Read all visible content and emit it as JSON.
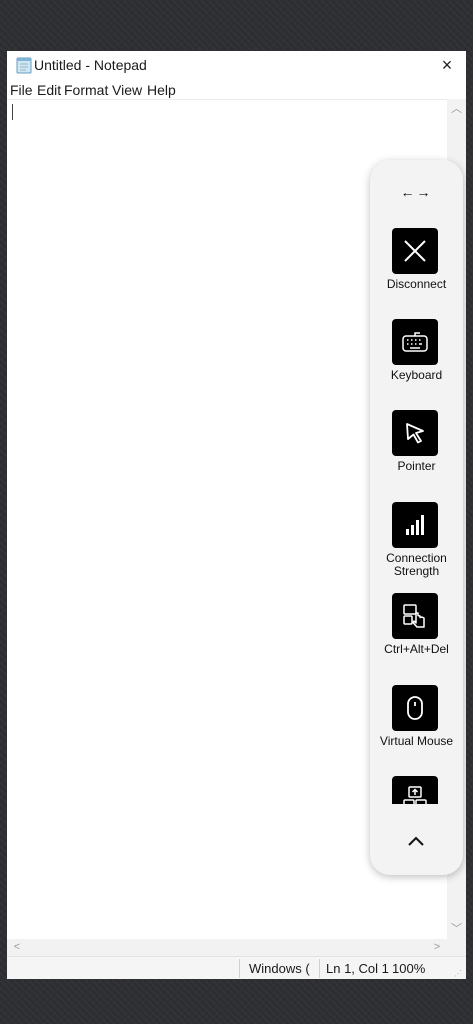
{
  "window": {
    "title": "Untitled - Notepad",
    "close_glyph": "×"
  },
  "menu": {
    "items": [
      "File",
      "Edit",
      "Format",
      "View",
      "Help"
    ]
  },
  "editor": {
    "content": ""
  },
  "statusbar": {
    "encoding": "Windows (",
    "position": "Ln 1, Col 1",
    "zoom": "100%"
  },
  "toolbar": {
    "handle": "←→",
    "items": [
      {
        "label": "Disconnect",
        "icon": "close-x-icon"
      },
      {
        "label": "Keyboard",
        "icon": "keyboard-icon"
      },
      {
        "label": "Pointer",
        "icon": "cursor-pointer-icon"
      },
      {
        "label": "Connection Strength",
        "icon": "signal-bars-icon"
      },
      {
        "label": "Ctrl+Alt+Del",
        "icon": "ctrl-alt-del-icon"
      },
      {
        "label": "Virtual Mouse",
        "icon": "mouse-icon"
      }
    ],
    "partial_item_icon": "upload-key-icon",
    "collapse_icon": "chevron-up-icon"
  },
  "colors": {
    "toolbar_bg": "#f3f3f3",
    "button_bg": "#000000",
    "desktop_bg": "#2e2f33"
  }
}
